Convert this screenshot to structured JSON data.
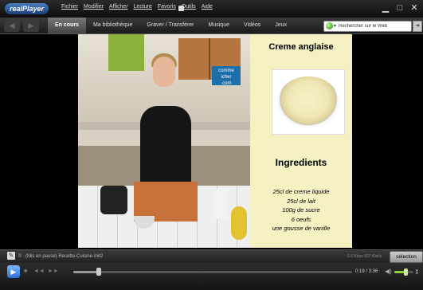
{
  "app": {
    "logo": "realPlayer"
  },
  "menu": [
    "Fichier",
    "Modifier",
    "Afficher",
    "Lecture",
    "Favoris",
    "Outils",
    "Aide"
  ],
  "window_controls": {
    "minimize": "▁",
    "maximize": "□",
    "close": "✕"
  },
  "toolbar": {
    "back": "◄",
    "forward": "►",
    "tabs": [
      {
        "label": "En cours",
        "active": true
      },
      {
        "label": "Ma bibliothèque",
        "active": false
      },
      {
        "label": "Graver / Transférer",
        "active": false
      },
      {
        "label": "Musique",
        "active": false
      },
      {
        "label": "Vidéos",
        "active": false
      },
      {
        "label": "Jeux",
        "active": false
      }
    ],
    "search_value": "Rechercher sur le Web",
    "search_go": "➜"
  },
  "video": {
    "brand": "comme\nicher\n.com",
    "recipe_title": "Creme anglaise",
    "ingredients_title": "Ingredients",
    "ingredients": [
      "25cl de creme liquide",
      "25cl de lait",
      "100g de sucre",
      "6 oeufs",
      "une gousse de vanille"
    ]
  },
  "status": {
    "pause_icon": "II",
    "text": "(Mis en pause) Recette-Cuisine-Init2",
    "kbps": "0.0 Kbps 607 Kbit/s",
    "selection_label": "sélection"
  },
  "controls": {
    "play": "▶",
    "progress_fraction": 0.09,
    "time": "0:19 / 3:36",
    "volume_fraction": 0.6,
    "stop_icon": "■",
    "prev_icon": "◄◄",
    "next_icon": "►►"
  },
  "colors": {
    "accent": "#2a6fd6",
    "frame_bg": "#f5f1c3",
    "volume": "#8fd12c"
  }
}
